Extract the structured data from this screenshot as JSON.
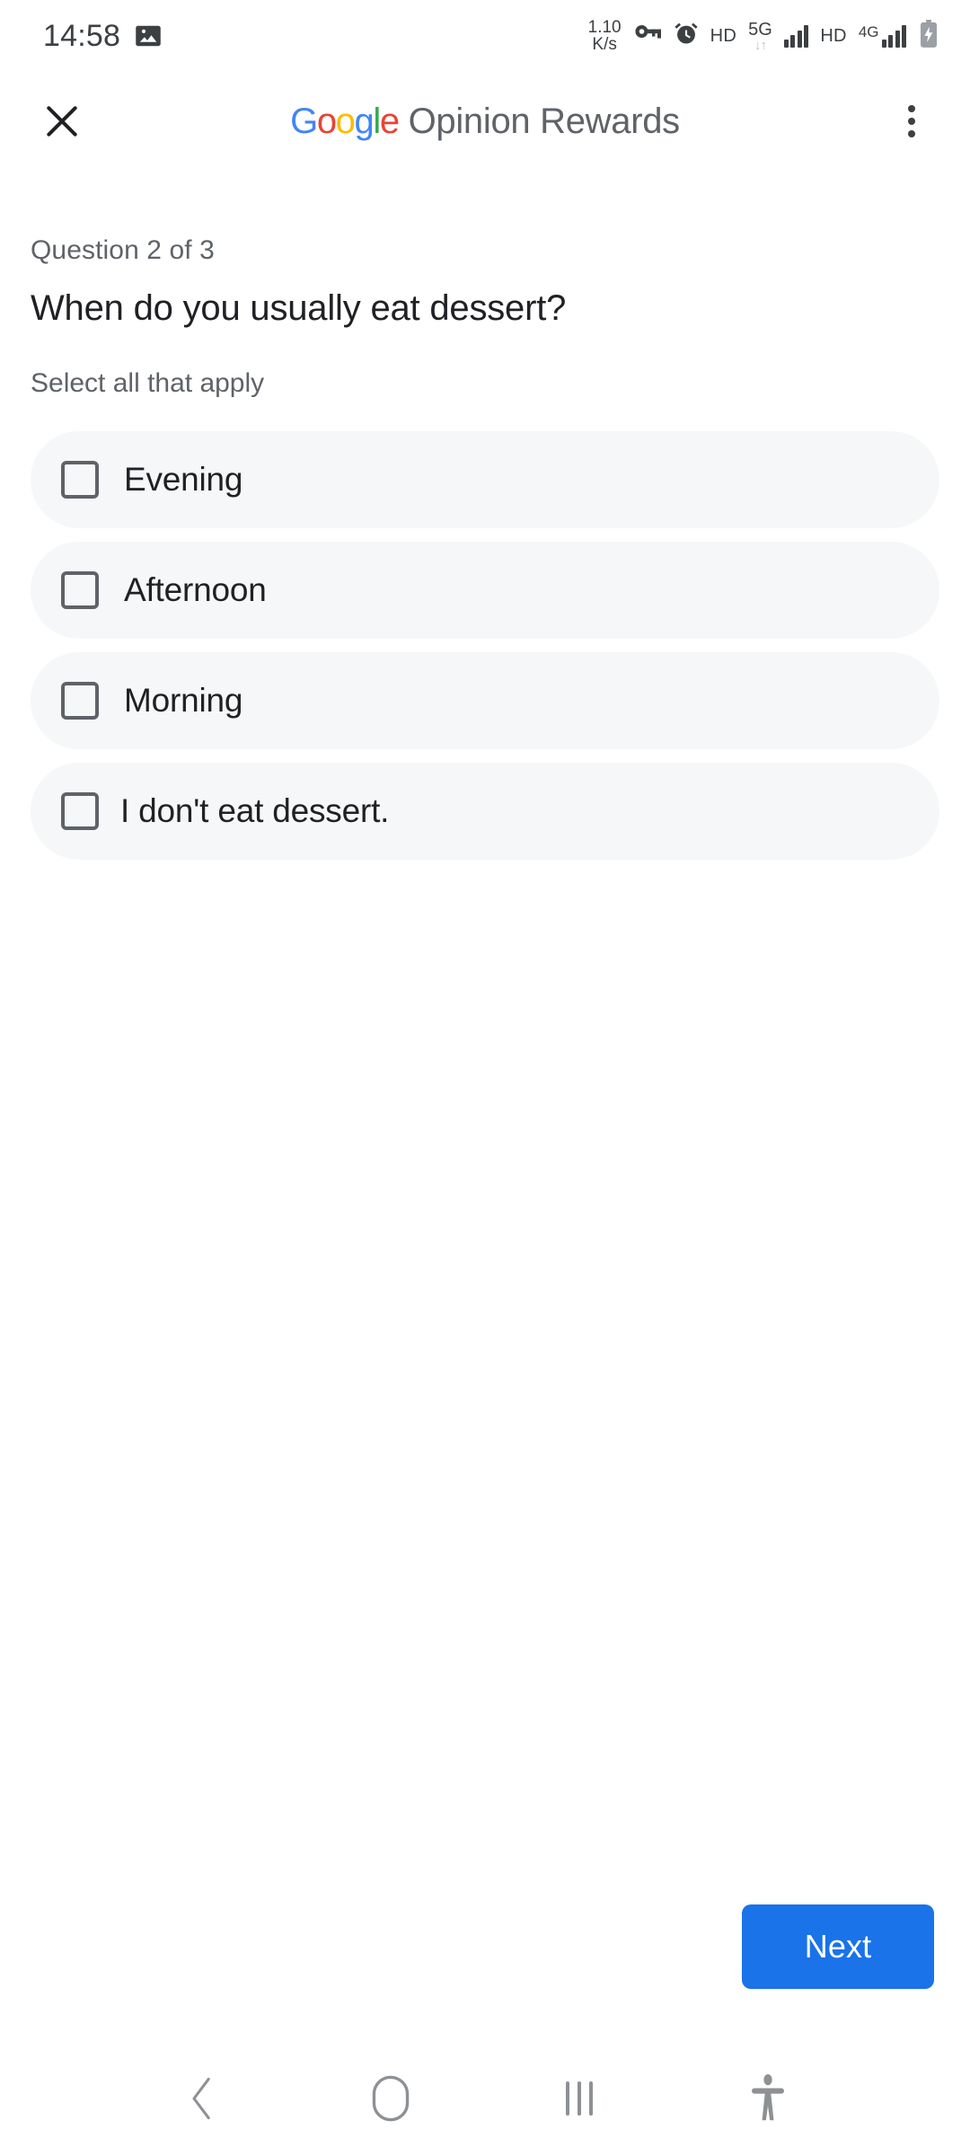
{
  "status_bar": {
    "time": "14:58",
    "icons_left": [
      "image-icon"
    ],
    "network_speed_value": "1.10",
    "network_speed_unit": "K/s",
    "icons_right": [
      "vpn-key-icon",
      "alarm-icon",
      "hd-icon",
      "5g-icon",
      "signal-icon",
      "hd-icon-2",
      "4g-signal-icon",
      "battery-charging-icon"
    ],
    "hd_label": "HD",
    "hd_label_2": "HD",
    "gen_label_5g": "5G",
    "gen_label_4g": "4G"
  },
  "app_bar": {
    "close_label": "✕",
    "brand_g1": "G",
    "brand_o1": "o",
    "brand_o2": "o",
    "brand_g2": "g",
    "brand_l": "l",
    "brand_e": "e",
    "title_rest": " Opinion Rewards",
    "overflow_menu": "more-options"
  },
  "survey": {
    "counter": "Question 2 of 3",
    "question": "When do you usually eat dessert?",
    "hint": "Select all that apply",
    "options": [
      {
        "label": "Evening",
        "checked": false
      },
      {
        "label": "Afternoon",
        "checked": false
      },
      {
        "label": "Morning",
        "checked": false
      },
      {
        "label": "I don't eat dessert.",
        "checked": false
      }
    ]
  },
  "footer": {
    "next_label": "Next"
  },
  "nav_bar": {
    "back": "back-icon",
    "home": "home-icon",
    "recents": "recents-icon",
    "accessibility": "accessibility-icon"
  },
  "colors": {
    "accent_blue": "#1a73e8",
    "google_blue": "#4285f4",
    "google_red": "#ea4335",
    "google_yellow": "#fbbc05",
    "google_green": "#34a853",
    "pill_bg": "#f5f7f8",
    "text_primary": "#202124",
    "text_secondary": "#5f6368"
  }
}
